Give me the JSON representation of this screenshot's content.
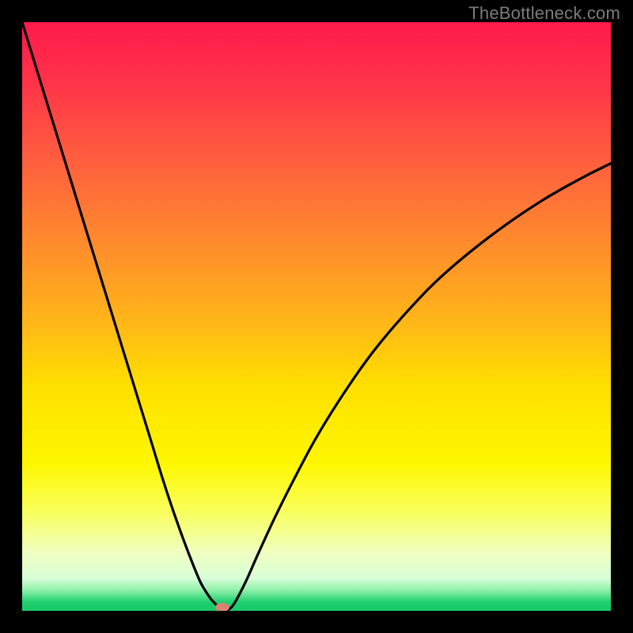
{
  "watermark": "TheBottleneck.com",
  "chart_data": {
    "type": "line",
    "title": "",
    "xlabel": "",
    "ylabel": "",
    "xlim": [
      0,
      100
    ],
    "ylim": [
      0,
      100
    ],
    "grid": false,
    "legend": false,
    "background_gradient": {
      "stops": [
        {
          "offset": 0.0,
          "color": "#ff1a4b"
        },
        {
          "offset": 0.1,
          "color": "#ff3249"
        },
        {
          "offset": 0.22,
          "color": "#ff5a40"
        },
        {
          "offset": 0.35,
          "color": "#ff8330"
        },
        {
          "offset": 0.5,
          "color": "#ffb31a"
        },
        {
          "offset": 0.62,
          "color": "#ffe000"
        },
        {
          "offset": 0.75,
          "color": "#fef700"
        },
        {
          "offset": 0.83,
          "color": "#f9ff5a"
        },
        {
          "offset": 0.9,
          "color": "#f0ffc0"
        },
        {
          "offset": 0.945,
          "color": "#d8ffd8"
        },
        {
          "offset": 0.965,
          "color": "#8ef0a8"
        },
        {
          "offset": 0.985,
          "color": "#20d070"
        },
        {
          "offset": 1.0,
          "color": "#18c868"
        }
      ]
    },
    "series": [
      {
        "name": "bottleneck-curve",
        "color": "#000000",
        "x": [
          0,
          2,
          4,
          6,
          8,
          10,
          12,
          14,
          16,
          18,
          20,
          22,
          24,
          26,
          28,
          30,
          31,
          32,
          33,
          33.8,
          34.5,
          35,
          36,
          38,
          40,
          43,
          46,
          50,
          55,
          60,
          66,
          72,
          80,
          88,
          95,
          100
        ],
        "y": [
          100,
          93.5,
          87,
          80.5,
          74,
          67.5,
          61,
          54.5,
          48,
          41.5,
          35,
          28.5,
          22,
          16,
          10.5,
          5.5,
          3.6,
          2.1,
          1.0,
          0.3,
          0.05,
          0.2,
          1.2,
          5.0,
          9.5,
          16,
          22,
          29.5,
          37.5,
          44.5,
          51.5,
          57.5,
          64,
          69.5,
          73.5,
          76
        ]
      }
    ],
    "markers": [
      {
        "name": "minimum-marker",
        "x": 34.0,
        "y": 0.6,
        "color": "#d9826f",
        "rx": 1.2,
        "ry": 0.75
      }
    ]
  }
}
